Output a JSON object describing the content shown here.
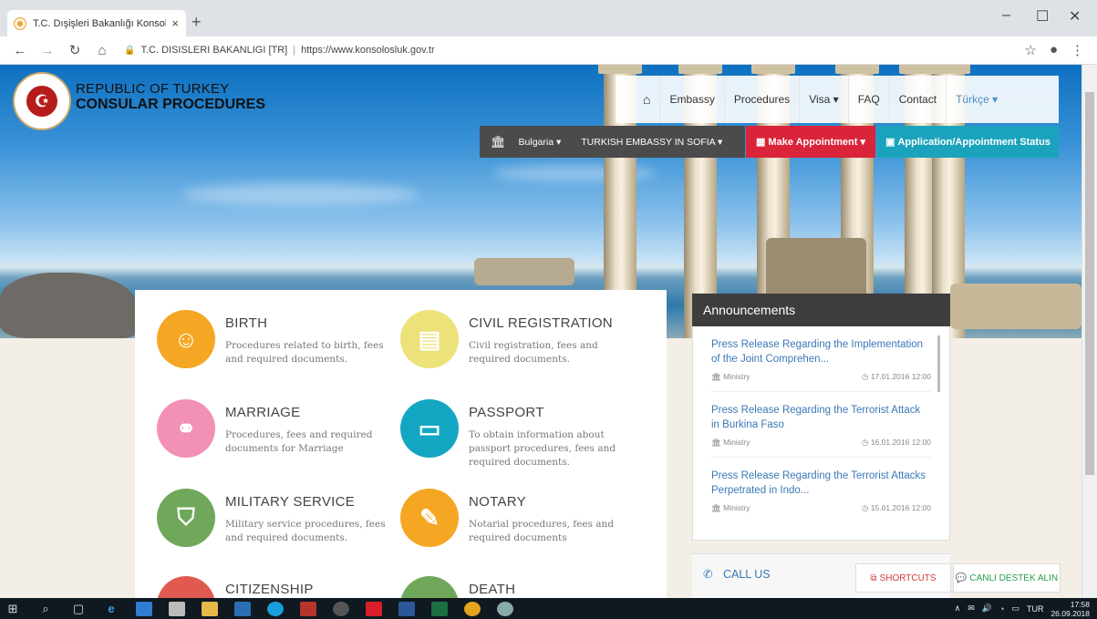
{
  "browser": {
    "tab_title": "T.C. Dışişleri Bakanlığı Konsolosluk",
    "tab_close": "×",
    "new_tab": "+",
    "site_name": "T.C. DISISLERI BAKANLIGI [TR]",
    "url": "https://www.konsolosluk.gov.tr",
    "window_controls": [
      "–",
      "☐",
      "✕"
    ]
  },
  "header": {
    "brand_line1": "REPUBLIC OF TURKEY",
    "brand_line2": "CONSULAR PROCEDURES",
    "nav": [
      {
        "label": "Embassy"
      },
      {
        "label": "Procedures"
      },
      {
        "label": "Visa ▾"
      },
      {
        "label": "FAQ"
      },
      {
        "label": "Contact"
      },
      {
        "label": "Türkçe ▾"
      }
    ],
    "country": "Bulgaria ▾",
    "mission": "TURKISH EMBASSY IN SOFIA ▾",
    "make_appointment": "Make Appointment ▾",
    "status": "Application/Appointment Status"
  },
  "services": [
    {
      "name": "BIRTH",
      "desc": "Procedures related to birth, fees and required documents.",
      "color": "#f5a623",
      "icon": "child-icon"
    },
    {
      "name": "CIVIL REGISTRATION",
      "desc": "Civil registration, fees and required documents.",
      "color": "#ece279",
      "icon": "document-icon"
    },
    {
      "name": "MARRIAGE",
      "desc": "Procedures, fees and required documents for Marriage",
      "color": "#f290b6",
      "icon": "couple-icon"
    },
    {
      "name": "PASSPORT",
      "desc": "To obtain information about passport procedures, fees and required documents.",
      "color": "#13a6c2",
      "icon": "passport-icon"
    },
    {
      "name": "MILITARY SERVICE",
      "desc": "Military service procedures, fees and required documents.",
      "color": "#6fa85a",
      "icon": "shield-icon"
    },
    {
      "name": "NOTARY",
      "desc": "Notarial procedures, fees and required documents",
      "color": "#f5a623",
      "icon": "pencil-icon"
    },
    {
      "name": "CITIZENSHIP",
      "desc": "",
      "color": "#e05a4f",
      "icon": "citizenship-icon"
    },
    {
      "name": "DEATH",
      "desc": "",
      "color": "#6fa85a",
      "icon": "death-icon"
    }
  ],
  "announcements": {
    "title": "Announcements",
    "items": [
      {
        "title": "Press Release Regarding the Implementation of the Joint Comprehen...",
        "source": "Ministry",
        "date": "17.01.2016 12:00"
      },
      {
        "title": "Press Release Regarding the Terrorist Attack in Burkina Faso",
        "source": "Ministry",
        "date": "16.01.2016 12:00"
      },
      {
        "title": "Press Release Regarding the Terrorist Attacks Perpetrated in Indo...",
        "source": "Ministry",
        "date": "15.01.2016 12:00"
      }
    ]
  },
  "call_us": "CALL US",
  "shortcuts": "SHORTCUTS",
  "live_support": "CANLI DESTEK ALIN",
  "taskbar": {
    "language": "TUR",
    "time": "17:58",
    "date": "26.09.2018"
  }
}
